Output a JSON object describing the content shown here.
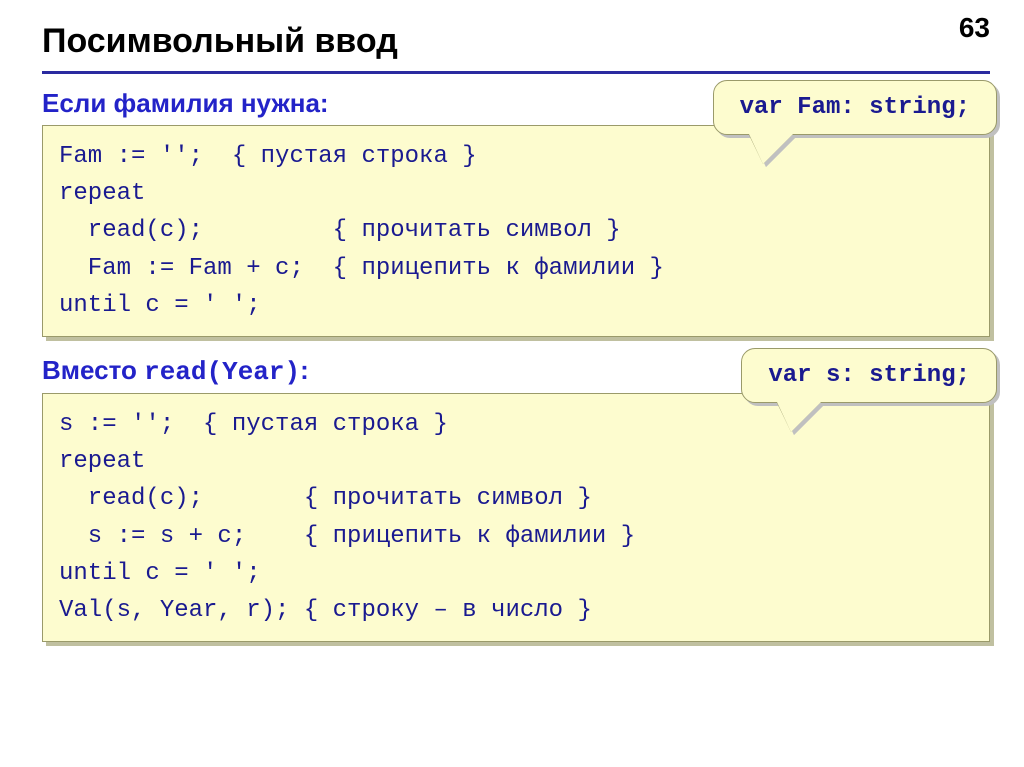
{
  "page_number": "63",
  "title": "Посимвольный ввод",
  "section1": {
    "heading": "Если фамилия нужна:",
    "callout": "var Fam: string;",
    "code": [
      "Fam := '';  { пустая строка }",
      "repeat",
      "  read(c);         { прочитать символ }",
      "  Fam := Fam + c;  { прицепить к фамилии }",
      "until c = ' ';"
    ]
  },
  "section2": {
    "heading_before": "Вместо ",
    "heading_mono": "read(Year)",
    "heading_after": ":",
    "callout": "var s: string;",
    "code": [
      "s := '';  { пустая строка }",
      "repeat",
      "  read(c);       { прочитать символ }",
      "  s := s + c;    { прицепить к фамилии }",
      "until c = ' ';",
      "Val(s, Year, r); { строку – в число }"
    ]
  }
}
